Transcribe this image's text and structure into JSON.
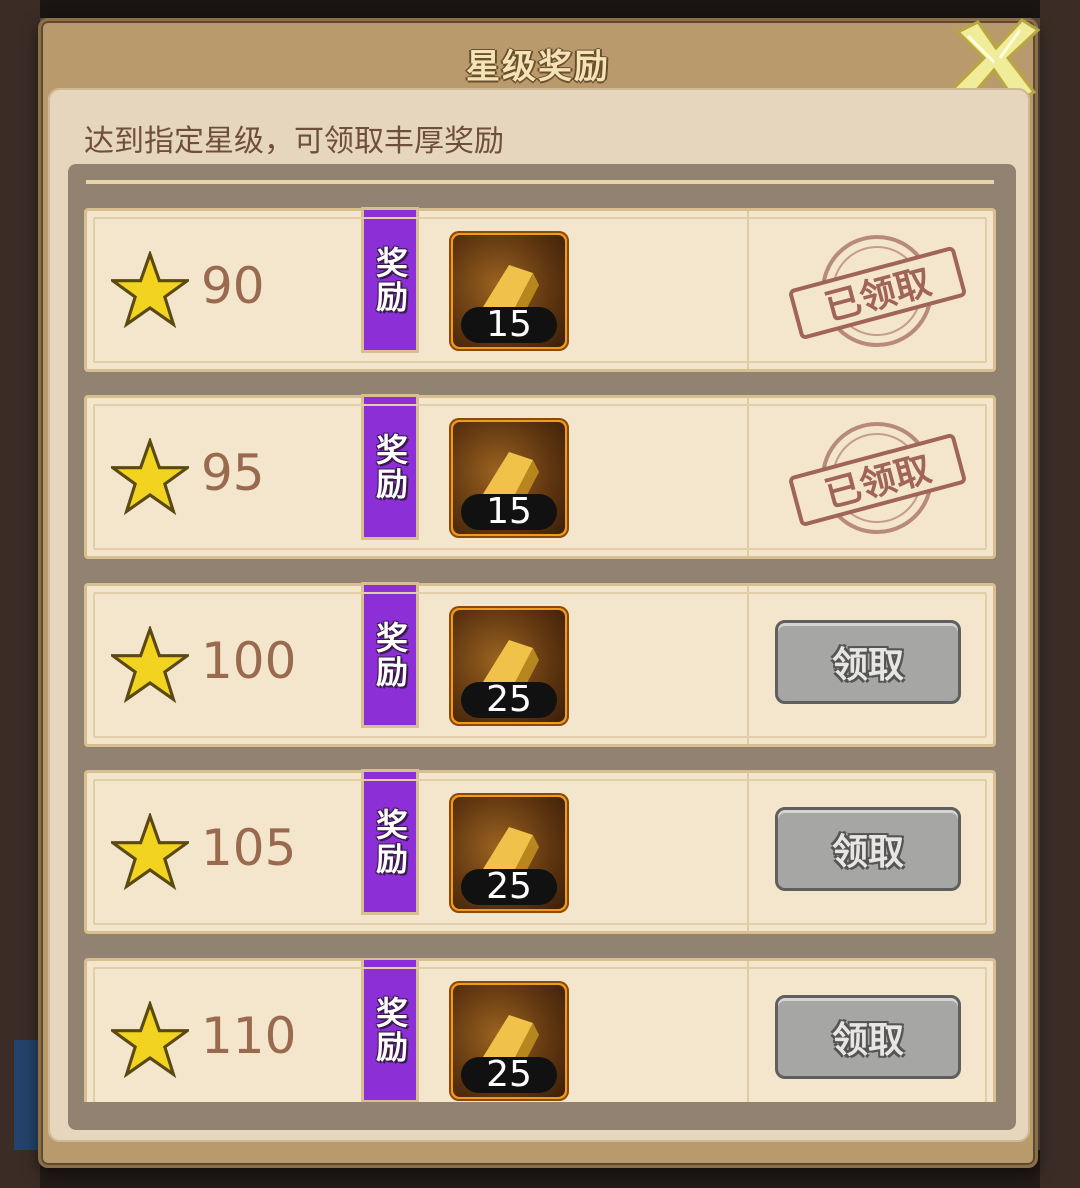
{
  "dialog": {
    "title": "星级奖励",
    "subtitle": "达到指定星级，可领取丰厚奖励"
  },
  "rows": [
    {
      "stars": "90",
      "tag": "奖励",
      "item_icon": "gold-bar-icon",
      "item_count": "15",
      "status": "claimed",
      "stamp_text": "已领取"
    },
    {
      "stars": "95",
      "tag": "奖励",
      "item_icon": "gold-bar-icon",
      "item_count": "15",
      "status": "claimed",
      "stamp_text": "已领取"
    },
    {
      "stars": "100",
      "tag": "奖励",
      "item_icon": "gold-bar-icon",
      "item_count": "25",
      "status": "available",
      "button_label": "领取"
    },
    {
      "stars": "105",
      "tag": "奖励",
      "item_icon": "gold-bar-icon",
      "item_count": "25",
      "status": "available",
      "button_label": "领取"
    },
    {
      "stars": "110",
      "tag": "奖励",
      "item_icon": "gold-bar-icon",
      "item_count": "25",
      "status": "available",
      "button_label": "领取"
    }
  ],
  "colors": {
    "tag_purple": "#8c2fd6",
    "item_frame_orange": "#f29a1c",
    "button_gray": "#a6a6a4",
    "stamp_red": "#a06458",
    "star_gold": "#f2d420"
  }
}
